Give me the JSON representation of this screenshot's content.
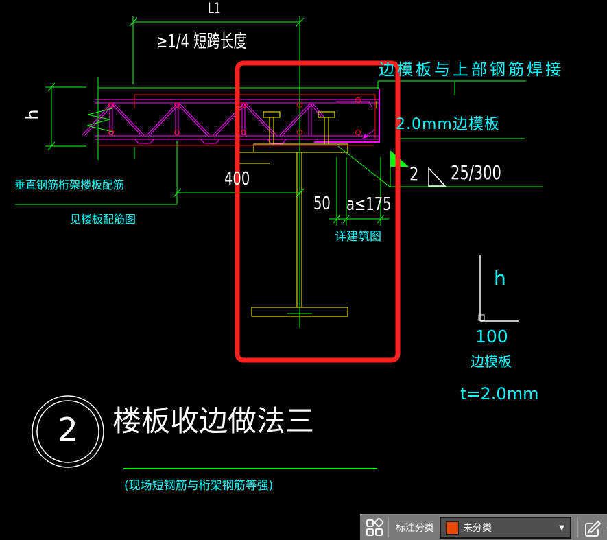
{
  "drawing": {
    "dimensions": {
      "l1": "L1",
      "span_note": "≥1/4 短跨长度",
      "h_left": "h",
      "dim_400": "400",
      "dim_50": "50",
      "dim_a": "a≤175"
    },
    "annotations": {
      "weld_note_top": "边模板与上部钢筋焊接",
      "formwork_note": "2.0mm边模板",
      "truss_label_line1": "垂直钢筋桁架楼板配筋",
      "truss_label_line2": "见楼板配筋图",
      "arch_ref": "详建筑图",
      "weld_count": "2",
      "weld_spec": "25/300"
    },
    "legend": {
      "h_label": "h",
      "dim_100": "100",
      "name": "边模板",
      "thickness": "t=2.0mm"
    },
    "title_block": {
      "number": "2",
      "title": "楼板收边做法三",
      "subtitle": "(现场短钢筋与桁架钢筋等强)"
    }
  },
  "toolbar": {
    "category_label": "标注分类",
    "dropdown_value": "未分类",
    "dropdown_caret": "▼"
  },
  "colors": {
    "background": "#000000",
    "line_green": "#00ff00",
    "line_magenta": "#ff00ff",
    "line_yellow": "#ffff00",
    "line_red": "#ff0000",
    "highlight_red": "#ff2020",
    "text_cyan": "#00ffff",
    "text_white": "#ffffff",
    "toolbar_bg": "#7b7b7b",
    "dropdown_bg": "#4f4f4f",
    "swatch_orange": "#e64a00"
  }
}
